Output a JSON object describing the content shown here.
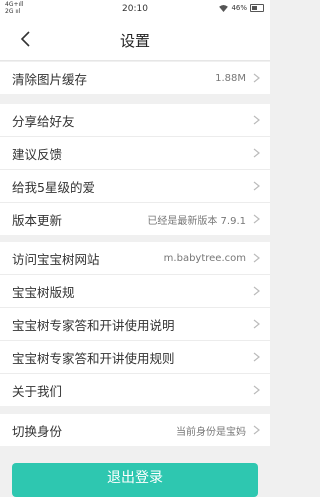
{
  "status_bar": {
    "signal_top": "4G+ıll",
    "signal_bottom": "2G ııl",
    "time": "20:10",
    "battery": "46%"
  },
  "header": {
    "title": "设置",
    "back_icon": "chevron-left-icon"
  },
  "groups": [
    {
      "items": [
        {
          "label": "清除图片缓存",
          "value": "1.88M"
        }
      ]
    },
    {
      "items": [
        {
          "label": "分享给好友",
          "value": ""
        },
        {
          "label": "建议反馈",
          "value": ""
        },
        {
          "label": "给我5星级的爱",
          "value": ""
        },
        {
          "label": "版本更新",
          "value": "已经是最新版本  7.9.1"
        }
      ]
    },
    {
      "items": [
        {
          "label": "访问宝宝树网站",
          "value": "m.babytree.com"
        },
        {
          "label": "宝宝树版规",
          "value": ""
        },
        {
          "label": "宝宝树专家答和开讲使用说明",
          "value": ""
        },
        {
          "label": "宝宝树专家答和开讲使用规则",
          "value": ""
        },
        {
          "label": "关于我们",
          "value": ""
        }
      ]
    },
    {
      "items": [
        {
          "label": "切换身份",
          "value": "当前身份是宝妈"
        }
      ]
    }
  ],
  "logout": {
    "label": "退出登录"
  },
  "colors": {
    "accent": "#2ec7b0",
    "background": "#f0f0f0"
  }
}
